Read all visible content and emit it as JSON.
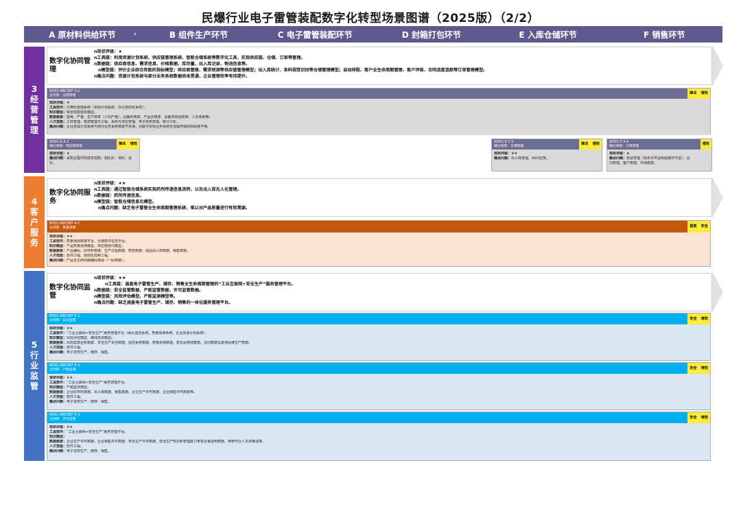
{
  "title": "民爆行业电子雷管装配数字化转型场景图谱（2025版）（2/2）",
  "colors": {
    "header": "#5e5a8e",
    "section3": "#7030a0",
    "section4": "#ed7d31",
    "section5": "#4472c4",
    "tag": "#ffeb3b",
    "card_head_grey": "#6c6d94",
    "card_head_orange": "#c4570e",
    "card_head_blue": "#00b0f0"
  },
  "stages": [
    {
      "label": "A 原材料供给环节",
      "icon": "chevron-right-icon",
      "arrow": "›"
    },
    {
      "label": "B 组件生产环节"
    },
    {
      "label": "C 电子雷管装配环节"
    },
    {
      "label": "D 封箱打包环节"
    },
    {
      "label": "E 入库仓储环节"
    },
    {
      "label": "F 销售环节"
    }
  ],
  "sections": [
    {
      "id": "s3",
      "chars": [
        "3",
        "经",
        "营",
        "管",
        "理"
      ]
    },
    {
      "id": "s4",
      "chars": [
        "4",
        "客",
        "户",
        "服",
        "务"
      ]
    },
    {
      "id": "s5",
      "chars": [
        "5",
        "行",
        "业",
        "监",
        "管"
      ]
    }
  ],
  "overviews": {
    "o3": {
      "name": "数字化协同管理",
      "lines": [
        "n现状评级：★",
        "n工具链：利用资源计划系统、供应链管理系统、智能仓储系统等数字化工具，实现供应链、仓储、订单等管理。",
        "n数据链：供应商信息、需求信息、价格数据、库存量、出入库记录、物流信息等。",
        "n模型链：评价企业综合效能的指标模型；供应商管理、需求预测等供应链管理模型；出入库统计、条码视觉识别等仓储管理模型；自动排程、客户全生命周期管理、客户评级、合同进度追踪等订单管理模型。",
        "n痛点问题：资源计划系统与部分业务系统数据尚未贯通，企业管理效率有待提升。"
      ]
    },
    "o4": {
      "name": "数字化协同服务",
      "lines": [
        "n现状评级：★★",
        "n工具链：通过智能仓储系统实现药剂传递信息流转，以及出入库无人化管理。",
        "n数据链：药剂传递信息。",
        "n模型链：智能仓储信息化模型。",
        "n痛点问题：缺乏电子雷管全生命周期管理系统，难以对产品质量进行有效溯源。"
      ]
    },
    "o5": {
      "name": "数字化协同监管",
      "lines": [
        "n现状评级：★★",
        "n工具链：涵盖电子雷管生产、储存、销售全生命周期管理的“工业互联网+安全生产”服务管理平台。",
        "n数据链：安全监管数据、产能监管数据、许可监管数据。",
        "n模型链：风险评估模型、产能监测模型等。",
        "n痛点问题：缺乏涵盖电子雷管生产、储存、销售的一体化服务管理平台。"
      ]
    }
  },
  "cards": {
    "c31": {
      "code": "W001-ABCDEF-3-1",
      "scene": "主场景：运营管理",
      "tags": [
        "降本",
        "增效"
      ],
      "rows": [
        {
          "k": "现状评级：",
          "v": "★"
        },
        {
          "k": "工具软件：",
          "v": "计算机管理系统（资源计划系统、办公自动化系统）。"
        },
        {
          "k": "知识模型：",
          "v": "综合效能指标模型。"
        },
        {
          "k": "数据要素：",
          "v": "能耗、产量、生产效率（人均产量）、设备利用率、产品合格率、设备有效运转率、人员考勤等。"
        },
        {
          "k": "人才技能：",
          "v": "工商管理、物流管理与工程、采购与供应管理、电子商务管理、统计分析。"
        },
        {
          "k": "痛点问题：",
          "v": "企业资源计划系统与部分业务系统数据不贯通，功能与实际业务系统全流程开展的匹配度不够。"
        }
      ]
    },
    "c32": {
      "code": "W001-A-3-2",
      "scene": "细分场景：供应链管理",
      "tags": [
        "降本",
        "增效"
      ],
      "rows": [
        {
          "k": "现状评级：",
          "v": "★"
        },
        {
          "k": "痛点问题：",
          "v": "采购过程中的成本控制，如比价、询价、议价。"
        }
      ]
    },
    "c33": {
      "code": "W001-E-3-3",
      "scene": "细分场景：仓储管理",
      "tags": [
        "降本",
        "增效"
      ],
      "rows": [
        {
          "k": "现状评级：",
          "v": "★★"
        },
        {
          "k": "痛点问题：",
          "v": "出入库管理、AGV应用。"
        }
      ]
    },
    "c34": {
      "code": "W001-F-3-4",
      "scene": "细分场景：订单管理",
      "tags": [
        "增效"
      ],
      "rows": [
        {
          "k": "现状评级：",
          "v": "★"
        },
        {
          "k": "痛点问题：",
          "v": "双证管理（购买许可证和运输许可证）、合"
        },
        {
          "k": "",
          "v": "同管理、客户管理、市场拓展。"
        }
      ]
    },
    "c41": {
      "code": "W001-ABCDEF-4-1",
      "scene": "主场景：质量溯源",
      "tags": [
        "提质",
        "安全"
      ],
      "rows": [
        {
          "k": "现状评级：",
          "v": "★★"
        },
        {
          "k": "工具软件：",
          "v": "质量溯源数据平台、仓储软件信息平台。"
        },
        {
          "k": "知识模型：",
          "v": "产品质量追溯模型、供应链协同模型。"
        },
        {
          "k": "数据要素：",
          "v": "产品编码、原材料数据、生产过程数据、质检数据、成品出入库数据、销售数据。"
        },
        {
          "k": "人才技能：",
          "v": "软件工程、自动化控制工程。"
        },
        {
          "k": "痛点问题：",
          "v": "产品全生命周期编码溯源（一码到底）。"
        }
      ]
    },
    "c51": {
      "code": "W001-ABCDEF-5-1",
      "scene": "主场景：安全监管",
      "tags": [
        "安全",
        "增效"
      ],
      "rows": [
        {
          "k": "现状评级：",
          "v": "★★"
        },
        {
          "k": "工具软件：",
          "v": "“工业互联网+安全生产”服务管理平台（网页监控系统、质量追溯系统、企业资源计划系统）。"
        },
        {
          "k": "知识模型：",
          "v": "风险评估模型、路线规划模型。"
        },
        {
          "k": "数据要素：",
          "v": "风险隐患台账数据、安全生产责任数据、监控系统数据、质量追溯数据、危化品物流数据、合同数据及其他民爆生产数据。"
        },
        {
          "k": "人才技能：",
          "v": "软件工程。"
        },
        {
          "k": "痛点问题：",
          "v": "电子雷管生产、储存、销售。"
        }
      ]
    },
    "c52": {
      "code": "W001-ABCDEF-5-2",
      "scene": "主场景：产能监测",
      "tags": [
        "安全",
        "增效"
      ],
      "rows": [
        {
          "k": "现状评级：",
          "v": "★★"
        },
        {
          "k": "工具软件：",
          "v": "“工业互联网+安全生产”服务管理平台。"
        },
        {
          "k": "知识模型：",
          "v": "产能监测模型。"
        },
        {
          "k": "数据要素：",
          "v": "企业原材料数据、出入库数据、销售数据、企业生产许可数据、企业销售许可数据等。"
        },
        {
          "k": "人才技能：",
          "v": "软件工程。"
        },
        {
          "k": "痛点问题：",
          "v": "电子雷管生产、储存、销售。"
        }
      ]
    },
    "c53": {
      "code": "W001-ABCDEF-5-3",
      "scene": "主场景：许可监管",
      "tags": [
        "安全",
        "增效"
      ],
      "rows": [
        {
          "k": "现状评级：",
          "v": "★★"
        },
        {
          "k": "工具软件：",
          "v": "“工业互联网+安全生产”服务管理平台。"
        },
        {
          "k": "知识模型：",
          "v": ""
        },
        {
          "k": "数据要素：",
          "v": "企业生产许可数据、企业销售许可数据、安全生产许可数据、安全生产知识和管理能力考核合格证明数据、特种作业人员资格证等。"
        },
        {
          "k": "人才技能：",
          "v": "软件工程。"
        },
        {
          "k": "痛点问题：",
          "v": "电子雷管生产、储存、销售。"
        }
      ]
    }
  }
}
